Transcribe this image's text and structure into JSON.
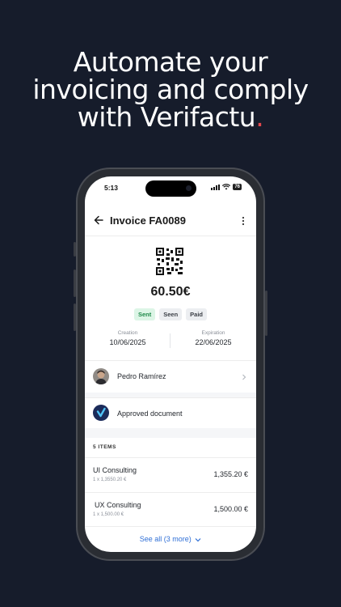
{
  "headline": {
    "line1": "Automate your",
    "line2": "invoicing and comply",
    "line3": "with Verifactu",
    "dot": "."
  },
  "status": {
    "time": "5:13",
    "battery": "76"
  },
  "appbar": {
    "title": "Invoice FA0089"
  },
  "invoice": {
    "amount": "60.50€",
    "badges": [
      "Sent",
      "Seen",
      "Paid"
    ],
    "creation_label": "Creation",
    "creation_value": "10/06/2025",
    "expiration_label": "Expiration",
    "expiration_value": "22/06/2025"
  },
  "client": {
    "name": "Pedro Ramírez"
  },
  "verification": {
    "label": "Approved document"
  },
  "items": {
    "header": "5 ITEMS",
    "list": [
      {
        "name": "UI Consulting",
        "detail": "1 x 1,3550.20 €",
        "price": "1,355.20 €"
      },
      {
        "name": "UX Consulting",
        "detail": "1 x 1,500.00 €",
        "price": "1,500.00 €"
      }
    ],
    "see_all": "See all (3 more)"
  },
  "colors": {
    "background": "#161c2b",
    "accent_dot": "#e5484d",
    "link": "#2f6fd6",
    "sent_badge": "#dcf5e6"
  }
}
